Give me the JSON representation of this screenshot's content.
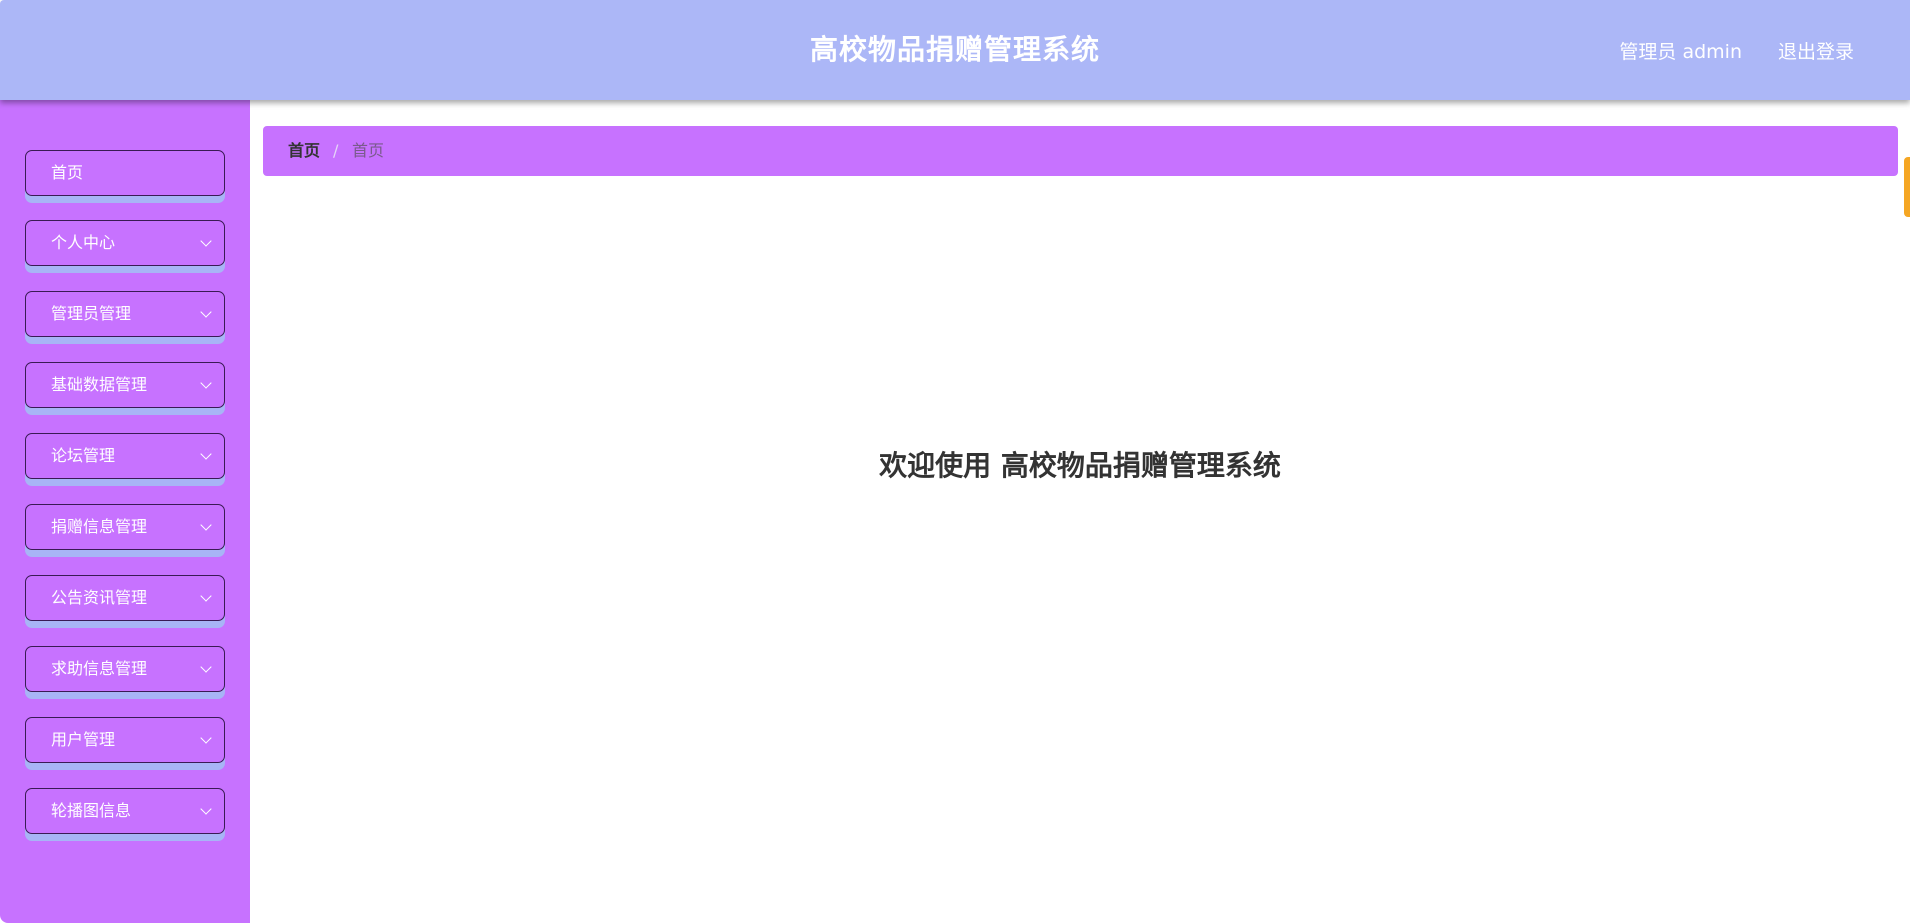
{
  "header": {
    "title": "高校物品捐赠管理系统",
    "user": "管理员 admin",
    "logout": "退出登录"
  },
  "sidebar": {
    "items": [
      {
        "label": "首页",
        "icon": "none"
      },
      {
        "label": "个人中心",
        "icon": "chevron-down-icon"
      },
      {
        "label": "管理员管理",
        "icon": "chevron-down-icon"
      },
      {
        "label": "基础数据管理",
        "icon": "chevron-down-icon"
      },
      {
        "label": "论坛管理",
        "icon": "chevron-down-icon"
      },
      {
        "label": "捐赠信息管理",
        "icon": "chevron-down-icon"
      },
      {
        "label": "公告资讯管理",
        "icon": "chevron-down-icon"
      },
      {
        "label": "求助信息管理",
        "icon": "chevron-down-icon"
      },
      {
        "label": "用户管理",
        "icon": "chevron-down-icon"
      },
      {
        "label": "轮播图信息",
        "icon": "chevron-down-icon"
      }
    ]
  },
  "breadcrumb": {
    "first": "首页",
    "separator": "/",
    "current": "首页"
  },
  "main": {
    "welcome": "欢迎使用 高校物品捐赠管理系统"
  },
  "colors": {
    "header_bg": "#acb7f7",
    "sidebar_bg": "#c772ff",
    "accent": "#f5a623"
  }
}
